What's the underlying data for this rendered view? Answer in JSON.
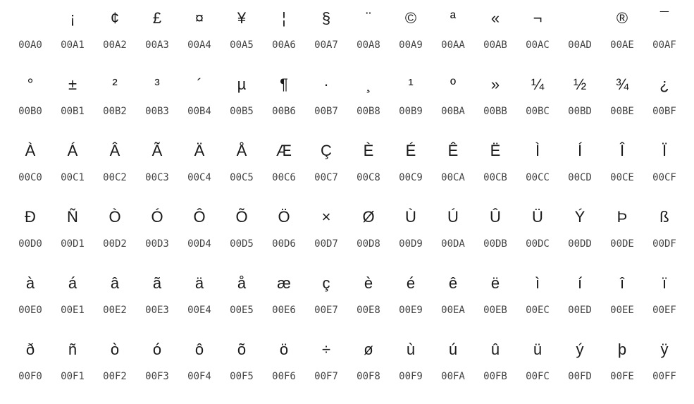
{
  "rows": [
    {
      "cells": [
        {
          "glyph": " ",
          "code": "00A0"
        },
        {
          "glyph": "¡",
          "code": "00A1"
        },
        {
          "glyph": "¢",
          "code": "00A2"
        },
        {
          "glyph": "£",
          "code": "00A3"
        },
        {
          "glyph": "¤",
          "code": "00A4"
        },
        {
          "glyph": "¥",
          "code": "00A5"
        },
        {
          "glyph": "¦",
          "code": "00A6"
        },
        {
          "glyph": "§",
          "code": "00A7"
        },
        {
          "glyph": "¨",
          "code": "00A8"
        },
        {
          "glyph": "©",
          "code": "00A9"
        },
        {
          "glyph": "ª",
          "code": "00AA"
        },
        {
          "glyph": "«",
          "code": "00AB"
        },
        {
          "glyph": "¬",
          "code": "00AC"
        },
        {
          "glyph": "",
          "code": "00AD"
        },
        {
          "glyph": "®",
          "code": "00AE"
        },
        {
          "glyph": "¯",
          "code": "00AF"
        }
      ]
    },
    {
      "cells": [
        {
          "glyph": "°",
          "code": "00B0"
        },
        {
          "glyph": "±",
          "code": "00B1"
        },
        {
          "glyph": "²",
          "code": "00B2"
        },
        {
          "glyph": "³",
          "code": "00B3"
        },
        {
          "glyph": "´",
          "code": "00B4"
        },
        {
          "glyph": "µ",
          "code": "00B5"
        },
        {
          "glyph": "¶",
          "code": "00B6"
        },
        {
          "glyph": "·",
          "code": "00B7"
        },
        {
          "glyph": "¸",
          "code": "00B8"
        },
        {
          "glyph": "¹",
          "code": "00B9"
        },
        {
          "glyph": "º",
          "code": "00BA"
        },
        {
          "glyph": "»",
          "code": "00BB"
        },
        {
          "glyph": "¼",
          "code": "00BC"
        },
        {
          "glyph": "½",
          "code": "00BD"
        },
        {
          "glyph": "¾",
          "code": "00BE"
        },
        {
          "glyph": "¿",
          "code": "00BF"
        }
      ]
    },
    {
      "cells": [
        {
          "glyph": "À",
          "code": "00C0"
        },
        {
          "glyph": "Á",
          "code": "00C1"
        },
        {
          "glyph": "Â",
          "code": "00C2"
        },
        {
          "glyph": "Ã",
          "code": "00C3"
        },
        {
          "glyph": "Ä",
          "code": "00C4"
        },
        {
          "glyph": "Å",
          "code": "00C5"
        },
        {
          "glyph": "Æ",
          "code": "00C6"
        },
        {
          "glyph": "Ç",
          "code": "00C7"
        },
        {
          "glyph": "È",
          "code": "00C8"
        },
        {
          "glyph": "É",
          "code": "00C9"
        },
        {
          "glyph": "Ê",
          "code": "00CA"
        },
        {
          "glyph": "Ë",
          "code": "00CB"
        },
        {
          "glyph": "Ì",
          "code": "00CC"
        },
        {
          "glyph": "Í",
          "code": "00CD"
        },
        {
          "glyph": "Î",
          "code": "00CE"
        },
        {
          "glyph": "Ï",
          "code": "00CF"
        }
      ]
    },
    {
      "cells": [
        {
          "glyph": "Ð",
          "code": "00D0"
        },
        {
          "glyph": "Ñ",
          "code": "00D1"
        },
        {
          "glyph": "Ò",
          "code": "00D2"
        },
        {
          "glyph": "Ó",
          "code": "00D3"
        },
        {
          "glyph": "Ô",
          "code": "00D4"
        },
        {
          "glyph": "Õ",
          "code": "00D5"
        },
        {
          "glyph": "Ö",
          "code": "00D6"
        },
        {
          "glyph": "×",
          "code": "00D7"
        },
        {
          "glyph": "Ø",
          "code": "00D8"
        },
        {
          "glyph": "Ù",
          "code": "00D9"
        },
        {
          "glyph": "Ú",
          "code": "00DA"
        },
        {
          "glyph": "Û",
          "code": "00DB"
        },
        {
          "glyph": "Ü",
          "code": "00DC"
        },
        {
          "glyph": "Ý",
          "code": "00DD"
        },
        {
          "glyph": "Þ",
          "code": "00DE"
        },
        {
          "glyph": "ß",
          "code": "00DF"
        }
      ]
    },
    {
      "cells": [
        {
          "glyph": "à",
          "code": "00E0"
        },
        {
          "glyph": "á",
          "code": "00E1"
        },
        {
          "glyph": "â",
          "code": "00E2"
        },
        {
          "glyph": "ã",
          "code": "00E3"
        },
        {
          "glyph": "ä",
          "code": "00E4"
        },
        {
          "glyph": "å",
          "code": "00E5"
        },
        {
          "glyph": "æ",
          "code": "00E6"
        },
        {
          "glyph": "ç",
          "code": "00E7"
        },
        {
          "glyph": "è",
          "code": "00E8"
        },
        {
          "glyph": "é",
          "code": "00E9"
        },
        {
          "glyph": "ê",
          "code": "00EA"
        },
        {
          "glyph": "ë",
          "code": "00EB"
        },
        {
          "glyph": "ì",
          "code": "00EC"
        },
        {
          "glyph": "í",
          "code": "00ED"
        },
        {
          "glyph": "î",
          "code": "00EE"
        },
        {
          "glyph": "ï",
          "code": "00EF"
        }
      ]
    },
    {
      "cells": [
        {
          "glyph": "ð",
          "code": "00F0"
        },
        {
          "glyph": "ñ",
          "code": "00F1"
        },
        {
          "glyph": "ò",
          "code": "00F2"
        },
        {
          "glyph": "ó",
          "code": "00F3"
        },
        {
          "glyph": "ô",
          "code": "00F4"
        },
        {
          "glyph": "õ",
          "code": "00F5"
        },
        {
          "glyph": "ö",
          "code": "00F6"
        },
        {
          "glyph": "÷",
          "code": "00F7"
        },
        {
          "glyph": "ø",
          "code": "00F8"
        },
        {
          "glyph": "ù",
          "code": "00F9"
        },
        {
          "glyph": "ú",
          "code": "00FA"
        },
        {
          "glyph": "û",
          "code": "00FB"
        },
        {
          "glyph": "ü",
          "code": "00FC"
        },
        {
          "glyph": "ý",
          "code": "00FD"
        },
        {
          "glyph": "þ",
          "code": "00FE"
        },
        {
          "glyph": "ÿ",
          "code": "00FF"
        }
      ]
    }
  ]
}
